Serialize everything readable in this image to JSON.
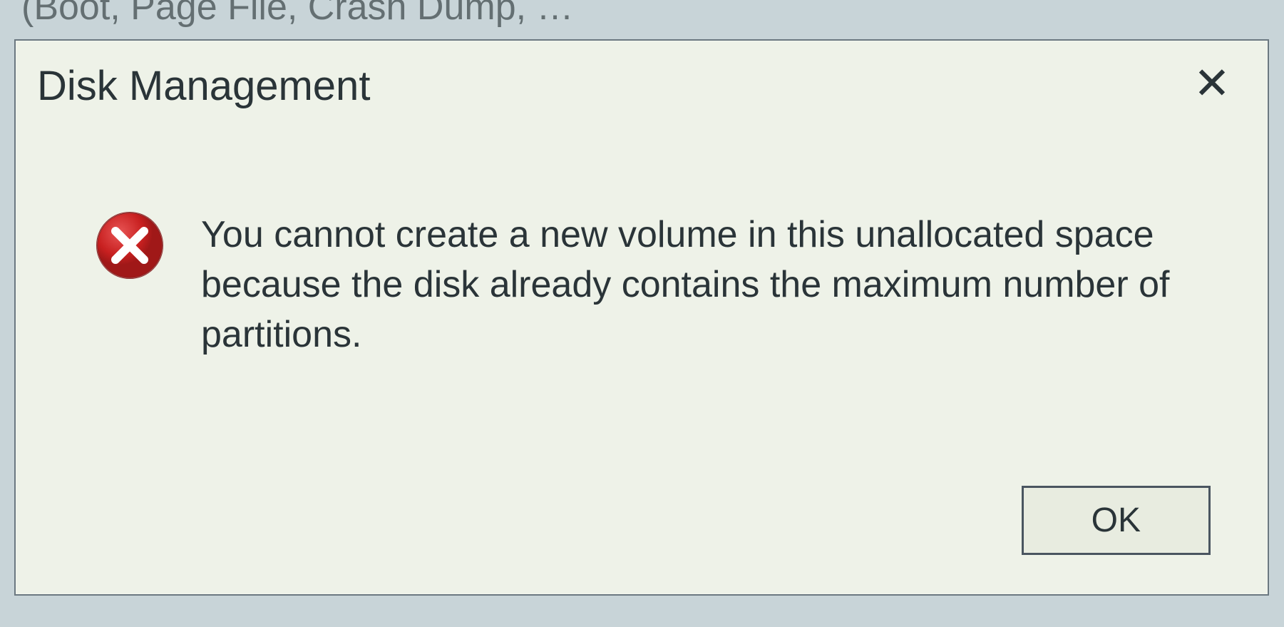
{
  "background": {
    "partial_text": "(Boot, Page File, Crash Dump, …"
  },
  "dialog": {
    "title": "Disk Management",
    "close_label": "✕",
    "message": "You cannot create a new volume in this unallocated space because the disk already contains the maximum number of partitions.",
    "ok_label": "OK"
  }
}
